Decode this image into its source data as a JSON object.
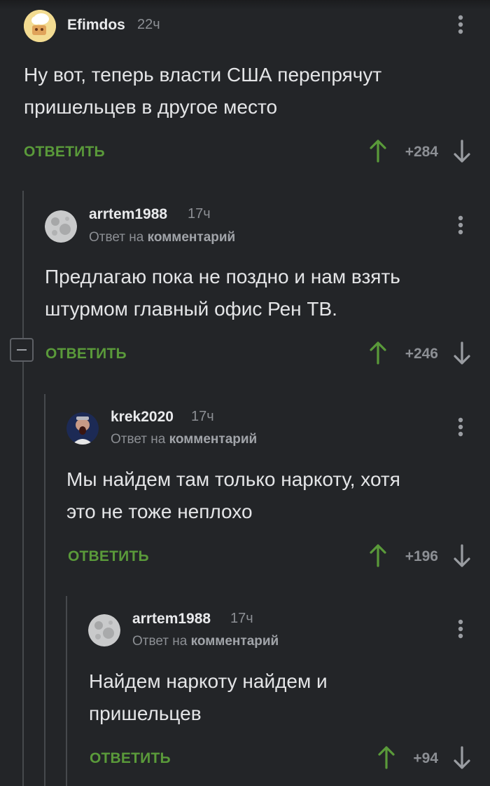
{
  "reply_label": "ОТВЕТИТЬ",
  "reply_to_prefix": "Ответ на",
  "reply_to_link": "комментарий",
  "colors": {
    "background": "#232528",
    "accent_green": "#5a9a3a",
    "muted": "#8c8f94",
    "text": "#e4e5e7"
  },
  "comments": [
    {
      "user": "Efimdos",
      "time": "22ч",
      "is_reply": false,
      "text": [
        "Ну вот, теперь власти США перепрячут",
        "пришельцев в другое место"
      ],
      "rating": "+284",
      "avatar_icon": "cartoon-avatar-icon"
    },
    {
      "user": "arrtem1988",
      "time": "17ч",
      "is_reply": true,
      "text": [
        "Предлагаю пока не поздно и нам взять",
        "штурмом главный офис Рен ТВ."
      ],
      "rating": "+246",
      "avatar_icon": "moon-avatar-icon"
    },
    {
      "user": "krek2020",
      "time": "17ч",
      "is_reply": true,
      "text": [
        "Мы найдем там только наркоту, хотя",
        "это не тоже неплохо"
      ],
      "rating": "+196",
      "avatar_icon": "photo-avatar-icon"
    },
    {
      "user": "arrtem1988",
      "time": "17ч",
      "is_reply": true,
      "text": [
        "Найдем наркоту найдем и",
        "пришельцев"
      ],
      "rating": "+94",
      "avatar_icon": "moon-avatar-icon"
    }
  ]
}
